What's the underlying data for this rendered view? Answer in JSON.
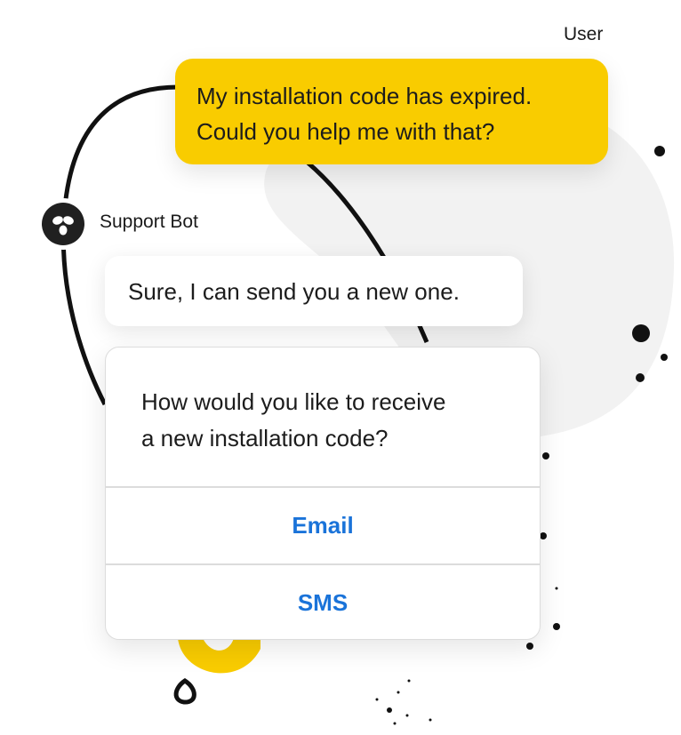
{
  "user": {
    "label": "User",
    "message_line1": "My installation code has expired.",
    "message_line2": "Could you help me with that?"
  },
  "bot": {
    "name": "Support Bot",
    "reply": "Sure, I can send you a new one.",
    "question_line1": "How would you like to receive",
    "question_line2": "a new installation code?",
    "options": [
      "Email",
      "SMS"
    ]
  },
  "colors": {
    "user_bubble": "#f9cc00",
    "accent_link": "#1a73d9",
    "avatar": "#202020",
    "background_blob": "#f2f2f2"
  }
}
